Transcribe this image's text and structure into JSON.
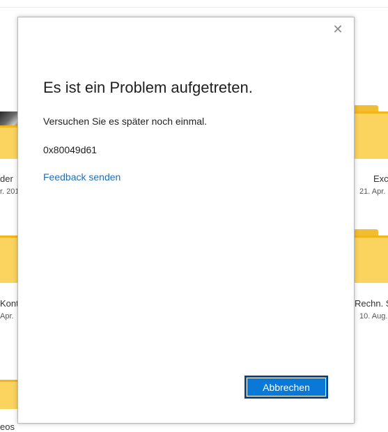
{
  "background": {
    "left_items": [
      {
        "name": "der",
        "date": "r. 201"
      },
      {
        "name": "Kont",
        "date": "Apr."
      },
      {
        "name": "eos",
        "date": ""
      }
    ],
    "right_items": [
      {
        "name": "Exce",
        "date": "21. Apr."
      },
      {
        "name": "Rechn. S",
        "date": "10. Aug."
      }
    ],
    "folder_color": "#fbd35f"
  },
  "dialog": {
    "close_icon": "close-icon",
    "close_glyph": "✕",
    "title": "Es ist ein Problem aufgetreten.",
    "message": "Versuchen Sie es später noch einmal.",
    "error_code": "0x80049d61",
    "feedback_link": "Feedback senden",
    "cancel_button": "Abbrechen",
    "accent_color": "#0a78d6",
    "link_color": "#1a6fbf"
  }
}
